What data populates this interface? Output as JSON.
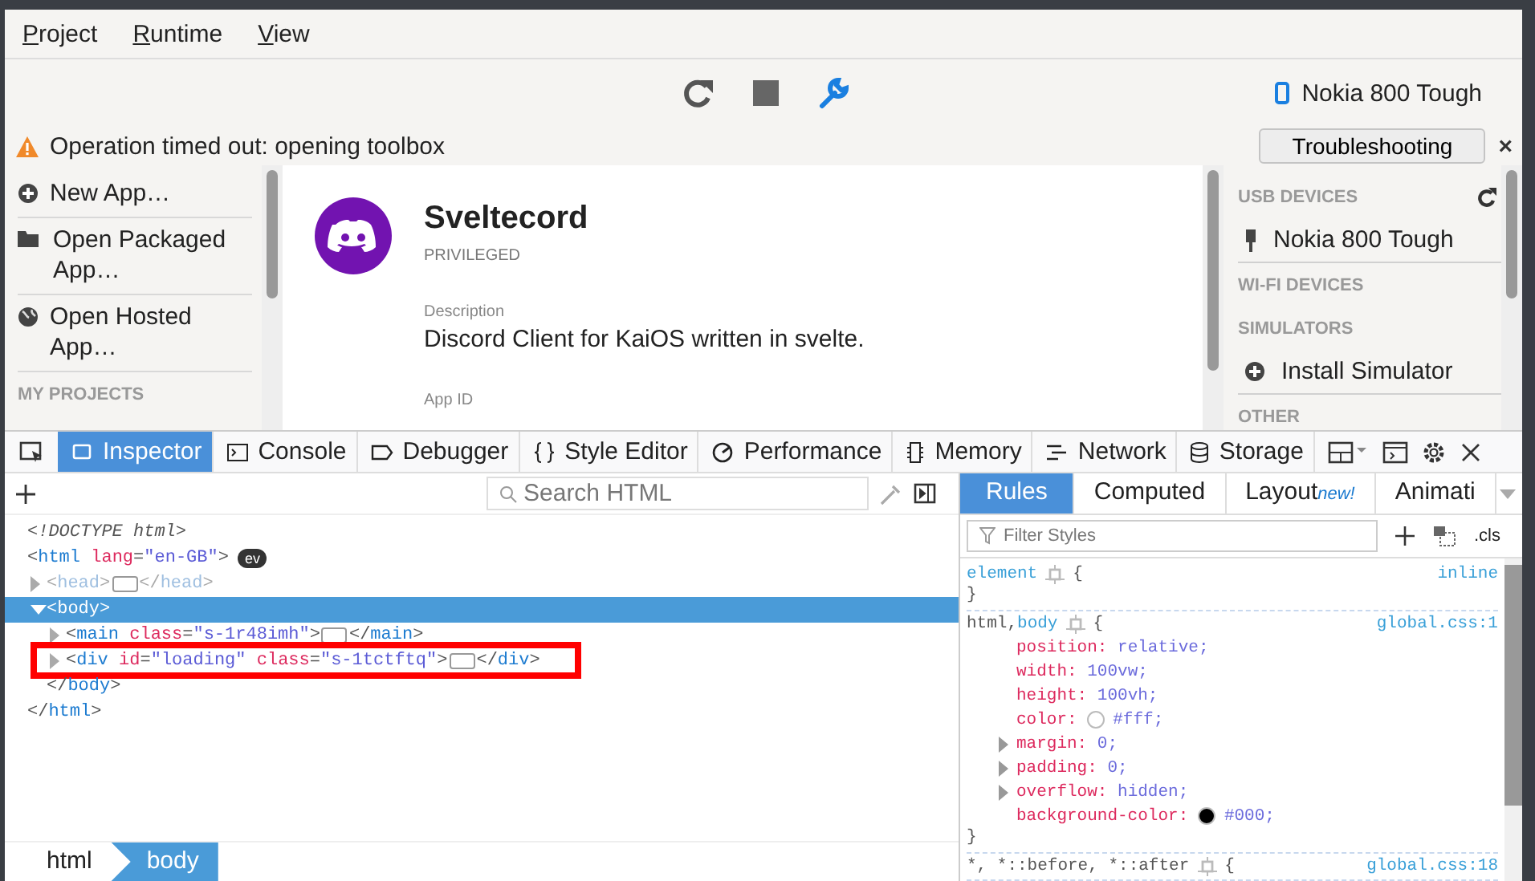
{
  "menu": [
    {
      "label": "Project"
    },
    {
      "label": "Runtime"
    },
    {
      "label": "View"
    }
  ],
  "toolbar": {
    "device": "Nokia 800 Tough"
  },
  "notification": {
    "message": "Operation timed out: opening toolbox",
    "button": "Troubleshooting",
    "close": "×"
  },
  "sidebar": {
    "items": [
      {
        "kind": "new",
        "label": "New App…"
      },
      {
        "kind": "packaged",
        "label": "Open Packaged App…"
      },
      {
        "kind": "hosted",
        "label": "Open Hosted App…"
      }
    ],
    "heading": "MY PROJECTS"
  },
  "app": {
    "name": "Sveltecord",
    "badge": "PRIVILEGED",
    "fields": [
      {
        "label": "Description",
        "value": "Discord Client for KaiOS written in svelte."
      },
      {
        "label": "App ID"
      }
    ]
  },
  "runtimes": {
    "sections": [
      {
        "heading": "USB DEVICES",
        "refresh": true,
        "items": [
          {
            "kind": "usb",
            "label": "Nokia 800 Tough"
          }
        ]
      },
      {
        "heading": "WI-FI DEVICES",
        "refresh": false
      },
      {
        "heading": "SIMULATORS",
        "refresh": false,
        "items": [
          {
            "kind": "install",
            "label": "Install Simulator"
          }
        ]
      },
      {
        "heading": "OTHER",
        "refresh": false
      }
    ]
  },
  "devtools": {
    "tabs": [
      {
        "kind": "inspector",
        "label": "Inspector",
        "selected": true
      },
      {
        "kind": "console",
        "label": "Console",
        "selected": false
      },
      {
        "kind": "debugger",
        "label": "Debugger",
        "selected": false
      },
      {
        "kind": "style",
        "label": "Style Editor",
        "selected": false
      },
      {
        "kind": "performance",
        "label": "Performance",
        "selected": false
      },
      {
        "kind": "memory",
        "label": "Memory",
        "selected": false
      },
      {
        "kind": "network",
        "label": "Network",
        "selected": false
      },
      {
        "kind": "storage",
        "label": "Storage",
        "selected": false
      }
    ],
    "search": {
      "placeholder": "Search HTML"
    },
    "tree": [
      {
        "tokens": [
          {
            "doctype": "<!DOCTYPE html>"
          }
        ],
        "expandable": false,
        "selected": false,
        "dimmed": false,
        "highlighted": false,
        "collapsed_content": false
      },
      {
        "tokens": [
          {
            "punct": "<"
          },
          {
            "tag": "html"
          },
          {
            "attr": " lang"
          },
          {
            "punct": "="
          },
          {
            "val": "\"en-GB\""
          },
          {
            "punct": ">"
          }
        ],
        "badge": "ev",
        "expandable": false,
        "selected": false,
        "dimmed": false,
        "highlighted": false,
        "collapsed_content": false,
        "children": [
          {
            "tokens": [
              {
                "punct": "<"
              },
              {
                "tag": "head"
              },
              {
                "punct": ">"
              }
            ],
            "close": [
              {
                "punct": "</"
              },
              {
                "tag": "head"
              },
              {
                "punct": ">"
              }
            ],
            "expandable": true,
            "expanded": false,
            "selected": false,
            "dimmed": true,
            "highlighted": false,
            "collapsed_content": true
          },
          {
            "tokens": [
              {
                "punct": "<"
              },
              {
                "tag": "body"
              },
              {
                "punct": ">"
              }
            ],
            "expandable": true,
            "expanded": true,
            "selected": true,
            "dimmed": false,
            "highlighted": false,
            "collapsed_content": false,
            "children": [
              {
                "tokens": [
                  {
                    "punct": "<"
                  },
                  {
                    "tag": "main"
                  },
                  {
                    "attr": " class"
                  },
                  {
                    "punct": "="
                  },
                  {
                    "val": "\"s-1r48imh\""
                  },
                  {
                    "punct": ">"
                  }
                ],
                "close": [
                  {
                    "punct": "</"
                  },
                  {
                    "tag": "main"
                  },
                  {
                    "punct": ">"
                  }
                ],
                "expandable": true,
                "expanded": false,
                "selected": false,
                "dimmed": false,
                "highlighted": false,
                "collapsed_content": true
              },
              {
                "tokens": [
                  {
                    "punct": "<"
                  },
                  {
                    "tag": "div"
                  },
                  {
                    "attr": " id"
                  },
                  {
                    "punct": "="
                  },
                  {
                    "val": "\"loading\""
                  },
                  {
                    "attr": " class"
                  },
                  {
                    "punct": "="
                  },
                  {
                    "val": "\"s-1tctftq\""
                  },
                  {
                    "punct": ">"
                  }
                ],
                "close": [
                  {
                    "punct": "</"
                  },
                  {
                    "tag": "div"
                  },
                  {
                    "punct": ">"
                  }
                ],
                "expandable": true,
                "expanded": false,
                "selected": false,
                "dimmed": false,
                "highlighted": true,
                "collapsed_content": true
              }
            ],
            "close": [
              {
                "punct": "</"
              },
              {
                "tag": "body"
              },
              {
                "punct": ">"
              }
            ]
          }
        ],
        "close": [
          {
            "punct": "</"
          },
          {
            "tag": "html"
          },
          {
            "punct": ">"
          }
        ]
      }
    ],
    "breadcrumbs": [
      {
        "label": "html",
        "selected": false
      },
      {
        "label": "body",
        "selected": true
      }
    ],
    "rule_tabs": [
      {
        "label": "Rules",
        "selected": true
      },
      {
        "label": "Computed",
        "selected": false
      },
      {
        "label": "Layout",
        "badge": "new!",
        "selected": false
      },
      {
        "label": "Animati",
        "selected": false
      }
    ],
    "filter": {
      "placeholder": "Filter Styles",
      "cls": ".cls"
    },
    "rules": [
      {
        "selector": [
          {
            "text": "element",
            "matched": true
          }
        ],
        "open": "{",
        "source": "inline",
        "close": "}"
      },
      {
        "selector": [
          {
            "text": "html,",
            "matched": false
          },
          {
            "text": "body",
            "matched": true
          }
        ],
        "open": "{",
        "source": "global.css:1",
        "close": "}",
        "declarations": [
          {
            "name": "position:",
            "value": "relative;",
            "expandable": false
          },
          {
            "name": "width:",
            "value": "100vw;",
            "expandable": false
          },
          {
            "name": "height:",
            "value": "100vh;",
            "expandable": false
          },
          {
            "name": "color:",
            "value": "#fff;",
            "color": "#ffffff",
            "expandable": false
          },
          {
            "name": "margin:",
            "value": "0;",
            "expandable": true
          },
          {
            "name": "padding:",
            "value": "0;",
            "expandable": true
          },
          {
            "name": "overflow:",
            "value": "hidden;",
            "expandable": true
          },
          {
            "name": "background-color:",
            "value": "#000;",
            "color": "#000000",
            "expandable": false
          }
        ]
      },
      {
        "selector": [
          {
            "text": "*, *::before, *::after",
            "matched": false
          }
        ],
        "open": "{",
        "source": "global.css:18"
      }
    ]
  }
}
